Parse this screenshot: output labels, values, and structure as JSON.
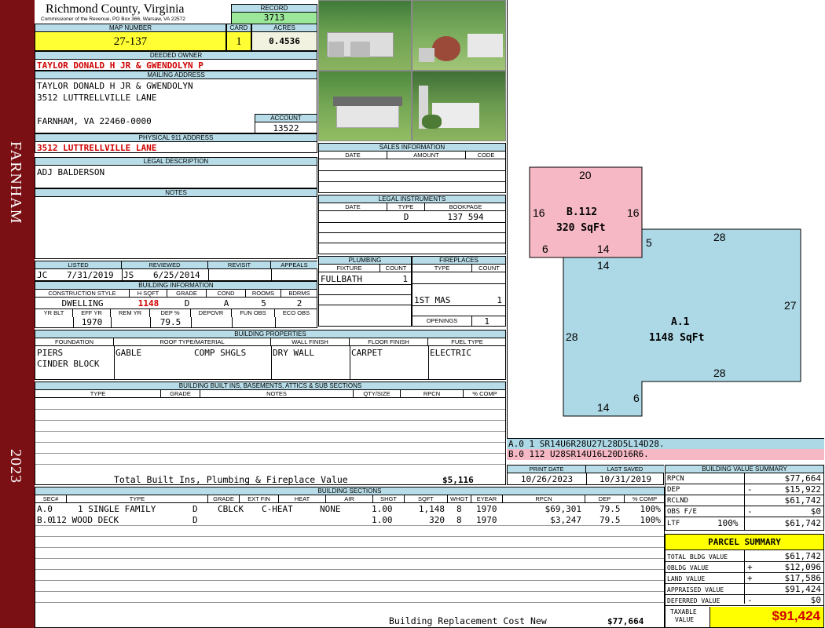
{
  "side": {
    "town": "FARNHAM",
    "year": "2023"
  },
  "county": {
    "title": "Richmond County, Virginia",
    "subtitle": "Commissioner of the Revenue, PO Box 366, Warsaw, VA 22572"
  },
  "record": {
    "label": "RECORD",
    "value": "3713"
  },
  "map": {
    "label": "MAP NUMBER",
    "value": "27-137"
  },
  "card": {
    "label": "CARD",
    "value": "1"
  },
  "acres": {
    "label": "ACRES",
    "value": "0.4536"
  },
  "owner": {
    "label": "DEEDED OWNER",
    "value": "TAYLOR DONALD H JR & GWENDOLYN P"
  },
  "mailing": {
    "label": "MAILING ADDRESS",
    "line1": "TAYLOR DONALD H JR & GWENDOLYN",
    "line2": "3512 LUTTRELLVILLE LANE",
    "line3": "FARNHAM, VA 22460-0000"
  },
  "account": {
    "label": "ACCOUNT",
    "value": "13522"
  },
  "physical": {
    "label": "PHYSICAL 911 ADDRESS",
    "value": "3512 LUTTRELLVILLE LANE"
  },
  "legal": {
    "label": "LEGAL DESCRIPTION",
    "value": "ADJ BALDERSON"
  },
  "notes": {
    "label": "NOTES"
  },
  "listing": {
    "h_listed": "LISTED",
    "h_reviewed": "REVIEWED",
    "h_revisit": "REVISIT",
    "h_appeals": "APPEALS",
    "listed_by": "JC",
    "listed_date": "7/31/2019",
    "reviewed_by": "JS",
    "reviewed_date": "6/25/2014"
  },
  "bldg_info": {
    "label": "BUILDING INFORMATION",
    "h_style": "CONSTRUCTION STYLE",
    "h_hsqft": "H SQFT",
    "h_grade": "GRADE",
    "h_cond": "COND",
    "h_rooms": "ROOMS",
    "h_bdrms": "BDRMS",
    "style": "DWELLING",
    "hsqft": "1148",
    "grade": "D",
    "cond": "A",
    "rooms": "5",
    "bdrms": "2",
    "h_yrblt": "YR BLT",
    "h_effyr": "EFF YR",
    "h_remyr": "REM YR",
    "h_dep": "DEP %",
    "h_depovr": "DEPOVR",
    "h_funobs": "FUN OBS",
    "h_ecoobs": "ECO OBS",
    "effyr": "1970",
    "dep": "79.5"
  },
  "sales": {
    "label": "SALES INFORMATION",
    "h_date": "DATE",
    "h_amount": "AMOUNT",
    "h_code": "CODE"
  },
  "instruments": {
    "label": "LEGAL INSTRUMENTS",
    "h_date": "DATE",
    "h_type": "TYPE",
    "h_book": "BOOKPAGE",
    "type": "D",
    "book": "137 594"
  },
  "plumbing": {
    "label": "PLUMBING",
    "h_fixture": "FIXTURE",
    "h_count": "COUNT",
    "fixture": "FULLBATH",
    "count": "1"
  },
  "fireplaces": {
    "label": "FIREPLACES",
    "h_type": "TYPE",
    "h_count": "COUNT",
    "type": "1ST MAS",
    "count": "1",
    "h_openings": "OPENINGS",
    "openings": "1"
  },
  "props": {
    "label": "BUILDING PROPERTIES",
    "h_foundation": "FOUNDATION",
    "h_roof": "ROOF TYPE/MATERIAL",
    "h_wall": "WALL FINISH",
    "h_floor": "FLOOR FINISH",
    "h_fuel": "FUEL TYPE",
    "foundation1": "PIERS",
    "foundation2": "CINDER BLOCK",
    "roof_type": "GABLE",
    "roof_mat": "COMP SHGLS",
    "wall": "DRY WALL",
    "floor": "CARPET",
    "fuel": "ELECTRIC"
  },
  "builtins": {
    "label": "BUILDING BUILT INS, BASEMENTS, ATTICS & SUB SECTIONS",
    "h_type": "TYPE",
    "h_grade": "GRADE",
    "h_notes": "NOTES",
    "h_qty": "QTY/SIZE",
    "h_rpcn": "RPCN",
    "h_comp": "% COMP",
    "total_label": "Total Built Ins, Plumbing & Fireplace Value",
    "total_value": "$5,116"
  },
  "print": {
    "h_print": "PRINT DATE",
    "h_saved": "LAST SAVED",
    "print_date": "10/26/2023",
    "saved_date": "10/31/2019"
  },
  "sections": {
    "label": "BUILDING SECTIONS",
    "h_sec": "SEC#",
    "h_type": "TYPE",
    "h_grade": "GRADE",
    "h_ext": "EXT FIN",
    "h_heat": "HEAT",
    "h_air": "AIR",
    "h_shgt": "SHGT",
    "h_sqft": "SQFT",
    "h_whgt": "WHGT",
    "h_eyear": "EYEAR",
    "h_rpcn": "RPCN",
    "h_dep": "DEP",
    "h_comp": "% COMP",
    "rows": [
      {
        "sec": "A.0",
        "type": "1 SINGLE FAMILY",
        "grade": "D",
        "ext": "CBLCK",
        "heat": "C-HEAT",
        "air": "NONE",
        "shgt": "1.00",
        "sqft": "1,148",
        "whgt": "8",
        "eyear": "1970",
        "rpcn": "$69,301",
        "dep": "79.5",
        "comp": "100%"
      },
      {
        "sec": "B.0",
        "type": "112 WOOD DECK",
        "grade": "D",
        "ext": "",
        "heat": "",
        "air": "",
        "shgt": "1.00",
        "sqft": "320",
        "whgt": "8",
        "eyear": "1970",
        "rpcn": "$3,247",
        "dep": "79.5",
        "comp": "100%"
      }
    ],
    "total_label": "Building Replacement Cost New",
    "total_value": "$77,664"
  },
  "sketch": {
    "b_label": "B.112",
    "b_sqft": "320 SqFt",
    "a_label": "A.1",
    "a_sqft": "1148 SqFt",
    "b_top": "20",
    "b_left": "16",
    "b_right": "16",
    "b_bl": "6",
    "b_bottom": "14",
    "a_5": "5",
    "a_top": "28",
    "a_14top": "14",
    "a_27": "27",
    "a_left": "28",
    "a_28b": "28",
    "a_6": "6",
    "a_14b": "14",
    "color_a": "#add8e6",
    "color_b": "#f5b8c4",
    "code_a": "A.0  1    SR14U6R28U27L28D5L14D28.",
    "code_b": "B.0  112  U28SR14U16L20D16R6."
  },
  "value_summary": {
    "label": "BUILDING VALUE SUMMARY",
    "rows": [
      {
        "name": "RPCN",
        "sign": "",
        "value": "$77,664"
      },
      {
        "name": "DEP",
        "sign": "-",
        "value": "$15,922"
      },
      {
        "name": "RCLND",
        "sign": "",
        "value": "$61,742"
      },
      {
        "name": "OBS F/E",
        "sign": "-",
        "value": "$0"
      },
      {
        "name": "LTF",
        "pct": "100%",
        "sign": "",
        "value": "$61,742"
      }
    ]
  },
  "parcel": {
    "label": "PARCEL SUMMARY",
    "rows": [
      {
        "name": "TOTAL BLDG VALUE",
        "sign": "",
        "value": "$61,742"
      },
      {
        "name": "OBLDG VALUE",
        "sign": "+",
        "value": "$12,096"
      },
      {
        "name": "LAND VALUE",
        "sign": "+",
        "value": "$17,586"
      },
      {
        "name": "APPRAISED VALUE",
        "sign": "",
        "value": "$91,424"
      },
      {
        "name": "DEFERRED VALUE",
        "sign": "-",
        "value": "$0"
      }
    ],
    "taxable_label1": "TAXABLE",
    "taxable_label2": "VALUE",
    "taxable_value": "$91,424",
    "accent": "#ffff00"
  }
}
